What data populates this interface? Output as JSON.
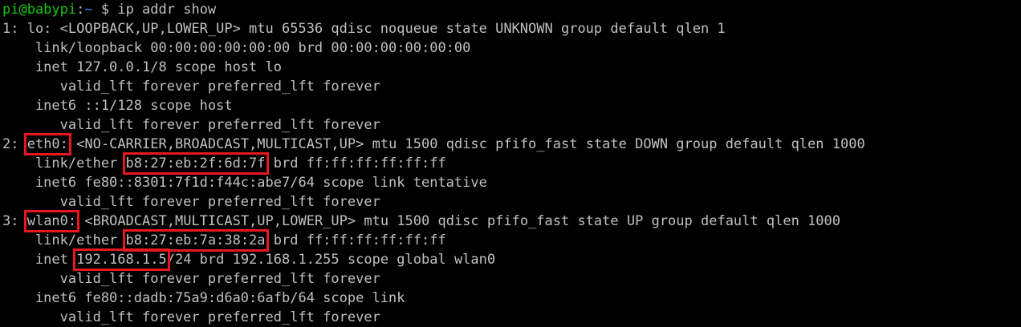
{
  "prompt": {
    "user_host": "pi@babypi",
    "colon": ":",
    "path": "~",
    "symbol": " $ ",
    "command": "ip addr show"
  },
  "lines": {
    "l1": "1: lo: <LOOPBACK,UP,LOWER_UP> mtu 65536 qdisc noqueue state UNKNOWN group default qlen 1",
    "l2": "    link/loopback 00:00:00:00:00:00 brd 00:00:00:00:00:00",
    "l3": "    inet 127.0.0.1/8 scope host lo",
    "l4": "       valid_lft forever preferred_lft forever",
    "l5": "    inet6 ::1/128 scope host",
    "l6": "       valid_lft forever preferred_lft forever",
    "l7_prefix": "2: ",
    "l7_iface": "eth0:",
    "l7_rest": " <NO-CARRIER,BROADCAST,MULTICAST,UP> mtu 1500 qdisc pfifo_fast state DOWN group default qlen 1000",
    "l8_prefix": "    link/ether ",
    "l8_mac": "b8:27:eb:2f:6d:7f",
    "l8_rest": " brd ff:ff:ff:ff:ff:ff",
    "l9": "    inet6 fe80::8301:7f1d:f44c:abe7/64 scope link tentative",
    "l10": "       valid_lft forever preferred_lft forever",
    "l11_prefix": "3: ",
    "l11_iface": "wlan0:",
    "l11_rest": " <BROADCAST,MULTICAST,UP,LOWER_UP> mtu 1500 qdisc pfifo_fast state UP group default qlen 1000",
    "l12_prefix": "    link/ether ",
    "l12_mac": "b8:27:eb:7a:38:2a",
    "l12_rest": " brd ff:ff:ff:ff:ff:ff",
    "l13_prefix": "    inet ",
    "l13_ip": "192.168.1.5",
    "l13_rest": "/24 brd 192.168.1.255 scope global wlan0",
    "l14": "       valid_lft forever preferred_lft forever",
    "l15": "    inet6 fe80::dadb:75a9:d6a0:6afb/64 scope link",
    "l16": "       valid_lft forever preferred_lft forever"
  },
  "colors": {
    "background": "#000000",
    "text": "#c0c0c0",
    "prompt_user": "#16c60c",
    "prompt_path": "#3b78ff",
    "highlight_box": "#e8171f"
  }
}
